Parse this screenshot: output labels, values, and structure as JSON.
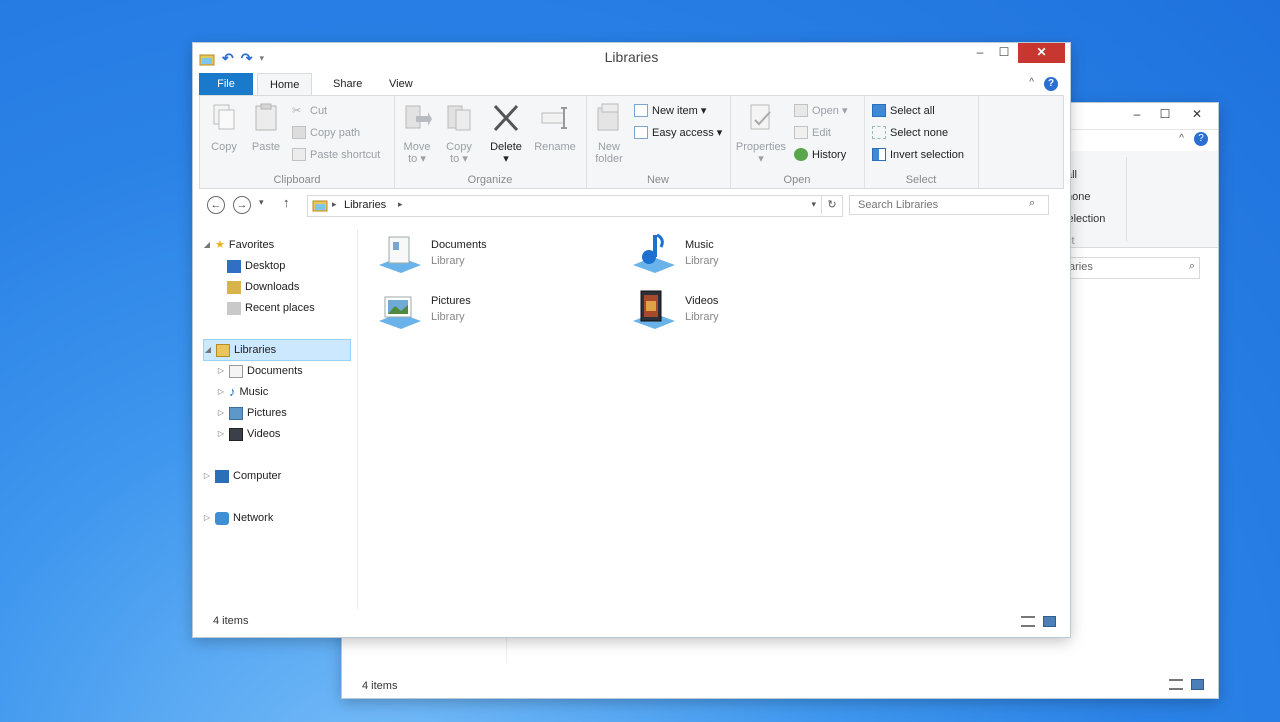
{
  "back_window": {
    "ribbon_fragments": [
      "all",
      "none",
      "selection",
      "ct"
    ],
    "search_fragment": "aries",
    "status": "4 items"
  },
  "window": {
    "title": "Libraries",
    "controls": {
      "minimize": "–",
      "maximize": "☐",
      "close": "✕"
    },
    "help": "?"
  },
  "tabs": [
    "File",
    "Home",
    "Share",
    "View"
  ],
  "ribbon": {
    "clipboard": {
      "label": "Clipboard",
      "copy": "Copy",
      "paste": "Paste",
      "cut": "Cut",
      "copy_path": "Copy path",
      "paste_shortcut": "Paste shortcut"
    },
    "organize": {
      "label": "Organize",
      "move_to_line1": "Move",
      "move_to_line2": "to ▾",
      "copy_to_line1": "Copy",
      "copy_to_line2": "to ▾",
      "delete": "Delete",
      "delete_arrow": "▾",
      "rename": "Rename"
    },
    "new": {
      "label": "New",
      "new_folder_line1": "New",
      "new_folder_line2": "folder",
      "new_item": "New item ▾",
      "easy_access": "Easy access ▾"
    },
    "open": {
      "label": "Open",
      "properties": "Properties",
      "properties_arrow": "▾",
      "open": "Open ▾",
      "edit": "Edit",
      "history": "History"
    },
    "select": {
      "label": "Select",
      "select_all": "Select all",
      "select_none": "Select none",
      "invert_selection": "Invert selection"
    }
  },
  "address": {
    "sep": "▸",
    "path": "Libraries",
    "search_placeholder": "Search Libraries"
  },
  "nav": {
    "favorites": "Favorites",
    "desktop": "Desktop",
    "downloads": "Downloads",
    "recent": "Recent places",
    "libraries": "Libraries",
    "documents": "Documents",
    "music": "Music",
    "pictures": "Pictures",
    "videos": "Videos",
    "computer": "Computer",
    "network": "Network"
  },
  "libraries": [
    {
      "name": "Documents",
      "type": "Library"
    },
    {
      "name": "Music",
      "type": "Library"
    },
    {
      "name": "Pictures",
      "type": "Library"
    },
    {
      "name": "Videos",
      "type": "Library"
    }
  ],
  "status": "4 items"
}
